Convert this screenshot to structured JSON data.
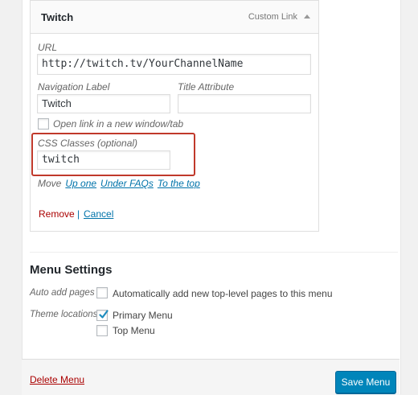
{
  "menu_item": {
    "title": "Twitch",
    "type": "Custom Link",
    "url_label": "URL",
    "url_value": "http://twitch.tv/YourChannelName",
    "nav_label_label": "Navigation Label",
    "nav_label_value": "Twitch",
    "title_attr_label": "Title Attribute",
    "title_attr_value": "",
    "new_window_label": "Open link in a new window/tab",
    "new_window_checked": false,
    "css_classes_label": "CSS Classes (optional)",
    "css_classes_value": "twitch",
    "move_label": "Move",
    "move_links": [
      "Up one",
      "Under FAQs",
      "To the top"
    ],
    "remove_label": "Remove",
    "separator": "|",
    "cancel_label": "Cancel"
  },
  "menu_settings": {
    "title": "Menu Settings",
    "auto_add_label": "Auto add pages",
    "auto_add_option": "Automatically add new top-level pages to this menu",
    "auto_add_checked": false,
    "theme_locations_label": "Theme locations",
    "locations": [
      {
        "label": "Primary Menu",
        "checked": true
      },
      {
        "label": "Top Menu",
        "checked": false
      }
    ]
  },
  "footer": {
    "delete_label": "Delete Menu",
    "save_label": "Save Menu"
  },
  "colors": {
    "accent": "#0085ba",
    "link": "#0073aa",
    "danger": "#aa0000",
    "highlight": "#c0392b"
  }
}
